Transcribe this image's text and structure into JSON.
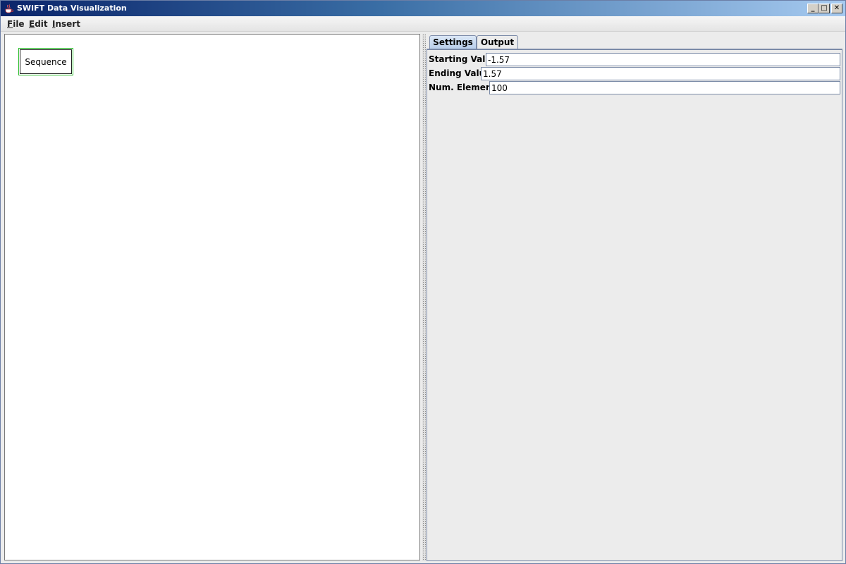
{
  "window": {
    "title": "SWIFT Data Visualization",
    "controls": {
      "minimize": "_",
      "maximize": "□",
      "close": "✕"
    }
  },
  "menubar": {
    "items": [
      {
        "label_first": "F",
        "label_rest": "ile"
      },
      {
        "label_first": "E",
        "label_rest": "dit"
      },
      {
        "label_first": "I",
        "label_rest": "nsert"
      }
    ]
  },
  "canvas": {
    "nodes": [
      {
        "label": "Sequence"
      }
    ]
  },
  "tabs": [
    {
      "label": "Settings",
      "selected": true
    },
    {
      "label": "Output",
      "selected": false
    }
  ],
  "settings": {
    "fields": [
      {
        "label": "Starting Value",
        "value": "-1.57"
      },
      {
        "label": "Ending Value",
        "value": "1.57"
      },
      {
        "label": "Num. Elements",
        "value": "100"
      }
    ]
  },
  "colors": {
    "title_gradient_start": "#0a246a",
    "title_gradient_end": "#a6caf0",
    "node_highlight": "#2fbf2f",
    "panel_background": "#ececec"
  }
}
